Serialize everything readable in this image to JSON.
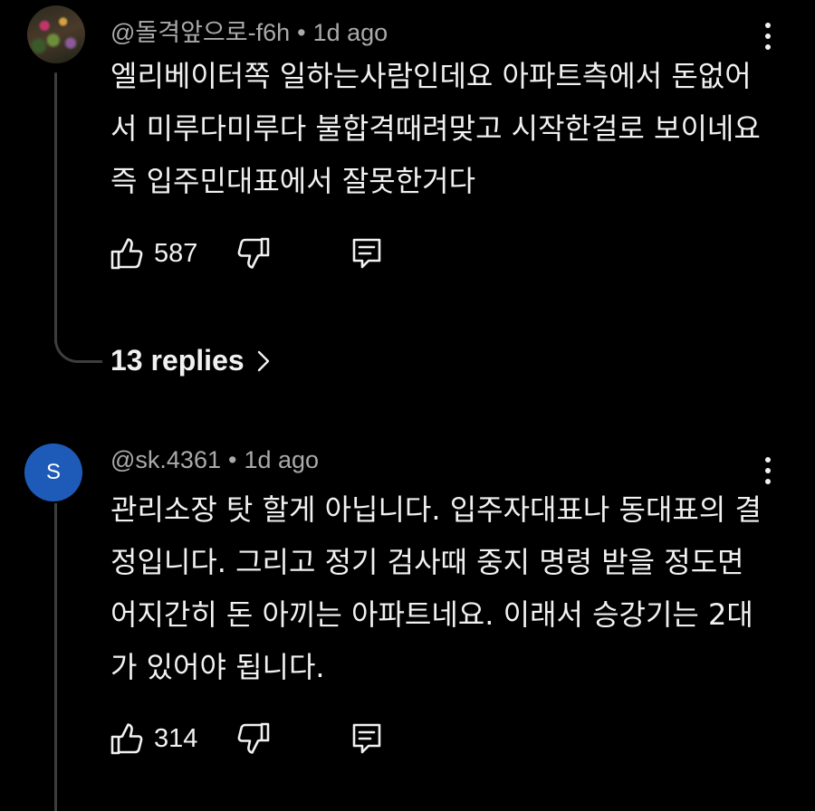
{
  "comments": [
    {
      "author": "@돌격앞으로-f6h",
      "time": "1d ago",
      "text": "엘리베이터쪽 일하는사람인데요 아파트측에서 돈없어서 미루다미루다 불합격때려맞고 시작한걸로 보이네요 즉 입주민대표에서 잘못한거다",
      "likes": "587",
      "replies_label": "13 replies"
    },
    {
      "author": "@sk.4361",
      "avatar_letter": "S",
      "time": "1d ago",
      "text": "관리소장 탓 할게 아닙니다. 입주자대표나 동대표의 결정입니다. 그리고 정기 검사때 중지 명령 받을 정도면 어지간히 돈 아끼는 아파트네요. 이래서 승강기는 2대가 있어야 됩니다.",
      "likes": "314"
    }
  ],
  "separator": "•",
  "colors": {
    "background": "#000000",
    "text": "#f1f1f1",
    "meta": "#aaaaaa",
    "avatar_letter_bg": "#1e5bb8",
    "thread_line": "#3d3d3d"
  },
  "icons": {
    "like": "thumbs-up-icon",
    "dislike": "thumbs-down-icon",
    "reply": "reply-comment-icon",
    "more": "more-vertical-icon",
    "chevron": "chevron-right-icon"
  }
}
